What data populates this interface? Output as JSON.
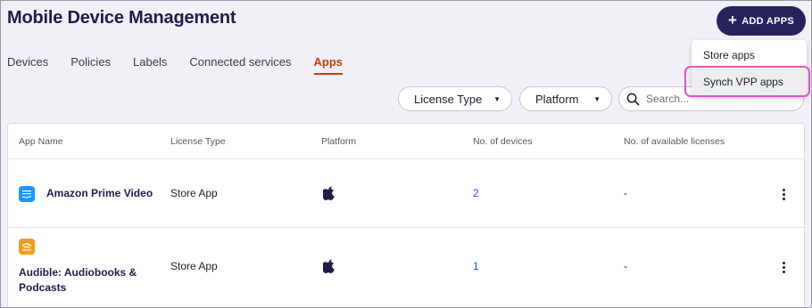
{
  "page": {
    "title": "Mobile Device Management"
  },
  "header": {
    "add_label": "ADD APPS"
  },
  "tabs": [
    {
      "label": "Devices",
      "active": false
    },
    {
      "label": "Policies",
      "active": false
    },
    {
      "label": "Labels",
      "active": false
    },
    {
      "label": "Connected services",
      "active": false
    },
    {
      "label": "Apps",
      "active": true
    }
  ],
  "filters": {
    "license_type": "License Type",
    "platform": "Platform",
    "search_placeholder": "Search..."
  },
  "table": {
    "columns": [
      "App Name",
      "License Type",
      "Platform",
      "No. of devices",
      "No. of available licenses"
    ],
    "rows": [
      {
        "name": "Amazon Prime Video",
        "license": "Store App",
        "platform_icon": "apple-icon",
        "devices": "2",
        "licenses": "-"
      },
      {
        "name_line1": "Audible: Audiobooks &",
        "name_line2": "Podcasts",
        "license": "Store App",
        "platform_icon": "apple-icon",
        "devices": "1",
        "licenses": "-"
      }
    ]
  },
  "dropdown": {
    "items": [
      "Store apps",
      "Synch VPP apps"
    ],
    "highlighted": "Synch VPP apps"
  },
  "colors": {
    "brand_dark": "#26235c",
    "accent": "#c2410c",
    "link": "#1d4ed8",
    "highlight": "#e64fc9"
  }
}
